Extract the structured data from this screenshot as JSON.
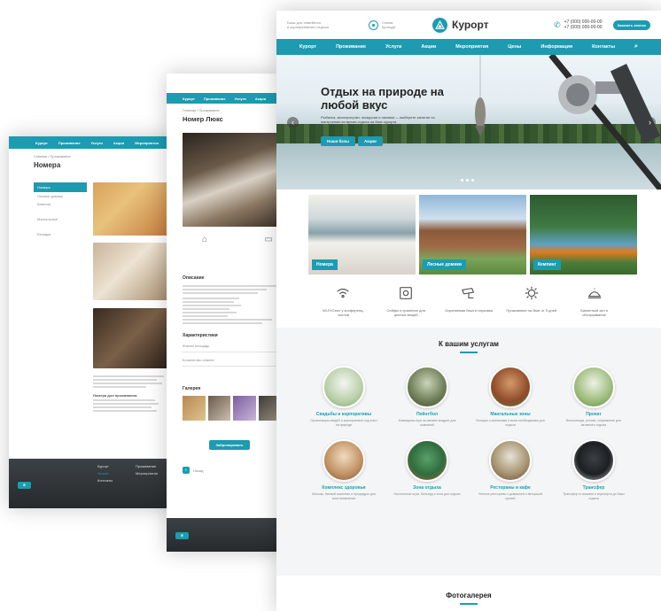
{
  "page3": {
    "brand": "Курорт",
    "top_left": [
      "Базы для семейного",
      "и корпоративного отдыха"
    ],
    "top_center": [
      "Схема",
      "проезда"
    ],
    "phones": [
      "+7 (000) 000-00-00",
      "+7 (000) 000-00-00"
    ],
    "callback": "Заказать звонок",
    "nav": [
      "Курорт",
      "Проживание",
      "Услуги",
      "Акции",
      "Мероприятия",
      "Цены",
      "Информация",
      "Контакты"
    ],
    "hero_title": "Отдых на природе на любой вкус",
    "hero_text": "Рыбалка, велопрогулки, экскурсии и пикники — выберите занятие по настроению во время отдыха на базе курорта",
    "hero_btn_1": "Наши базы",
    "hero_btn_2": "Акции",
    "tiles": [
      "Номера",
      "Лесные домики",
      "Кемпинг"
    ],
    "features": [
      "Wi-Fi/Сеют у конференц-холлов",
      "Сейфы и хранение для ценных вещей",
      "Охраняемая база и парковка",
      "Проживание на базе от 5 дней",
      "Банкетный зал и обслуживание"
    ],
    "services_title": "К вашим услугам",
    "services": [
      {
        "name": "Свадьбы и корпоративы",
        "text": "Организация свадеб и корпоративов под ключ на природе"
      },
      {
        "name": "Пейнтбол",
        "text": "Командная игра на свежем воздухе для компаний"
      },
      {
        "name": "Мангальные зоны",
        "text": "Беседки с мангалами и всем необходимым для отдыха"
      },
      {
        "name": "Прокат",
        "text": "Велосипеды, ролики, снаряжение для активного отдыха"
      },
      {
        "name": "Комплекс здоровья",
        "text": "Массаж, банный комплекс и процедуры для восстановления"
      },
      {
        "name": "Зона отдыха",
        "text": "Настольные игры, бильярд и зона для отдыха"
      },
      {
        "name": "Рестораны и кафе",
        "text": "Уютные рестораны с домашней и авторской кухней"
      },
      {
        "name": "Трансфер",
        "text": "Трансфер от вокзала и аэропорта до базы отдыха"
      }
    ],
    "gallery_title": "Фотогалерея"
  },
  "page2": {
    "breadcrumb": "Главная / Проживание",
    "title": "Номер Люкс",
    "desc_head": "Описание",
    "spec_head": "Характеристики",
    "spec_rows": [
      "Жилая площадь",
      "Количество спален"
    ],
    "gallery_head": "Галерея",
    "button": "Забронировать",
    "nav": [
      "Курорт",
      "Проживание",
      "Услуги",
      "Акции"
    ],
    "back": "Назад"
  },
  "page1": {
    "breadcrumb": "Главная / Проживание",
    "title": "Номера",
    "nav": [
      "Курорт",
      "Проживание",
      "Услуги",
      "Акции",
      "Мероприятия"
    ],
    "sidebar": [
      "Номера",
      "Лесные домики",
      "Кемпинг",
      "Мангальные",
      "Беседки"
    ],
    "prices_head": "Номера для проживания:",
    "footer": [
      "Курорт",
      "Проживание",
      "Услуги",
      "Мероприятия",
      "Контакты"
    ]
  },
  "colors": {
    "accent": "#1d9bb0"
  }
}
